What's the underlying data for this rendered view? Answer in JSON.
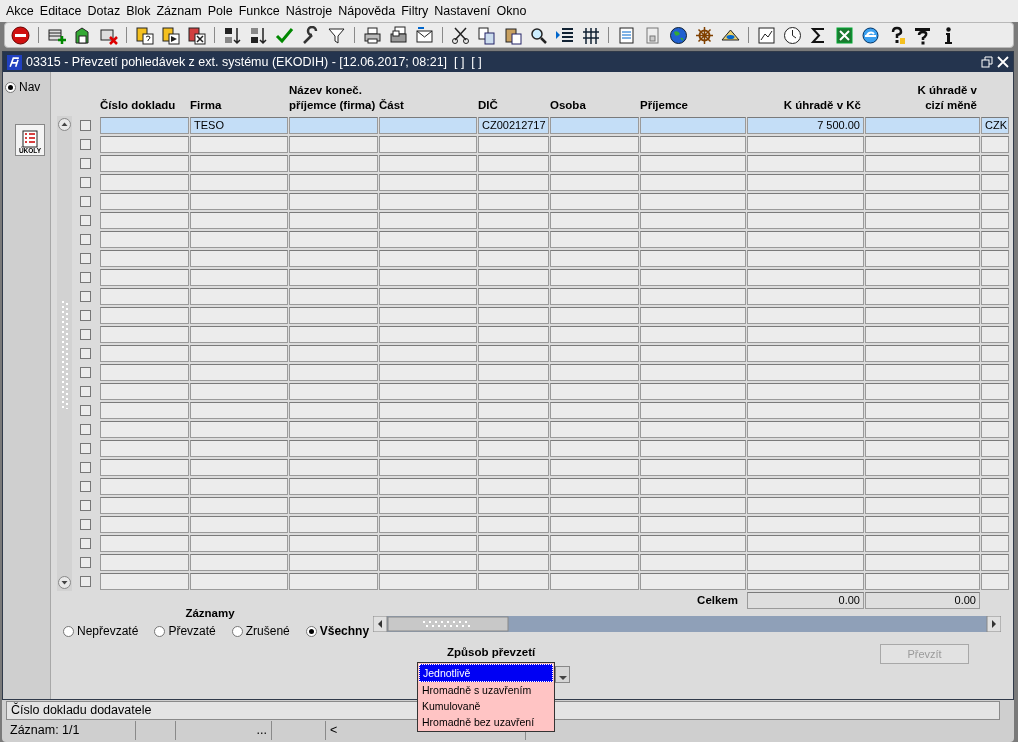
{
  "menu": [
    "Akce",
    "Editace",
    "Dotaz",
    "Blok",
    "Záznam",
    "Pole",
    "Funkce",
    "Nástroje",
    "Nápověda",
    "Filtry",
    "Nastavení",
    "Okno"
  ],
  "window": {
    "title": "03315 - Převzetí pohledávek z ext. systému (EKODIH) - [12.06.2017; 08:21]  [ ]  [ ]"
  },
  "nav": {
    "label": "Nav",
    "selected": true,
    "button": "ÚKOLY"
  },
  "table": {
    "columns": [
      {
        "label": "Číslo dokladu",
        "kind": "text"
      },
      {
        "label": "Firma",
        "kind": "text"
      },
      {
        "label": "Název koneč. příjemce (firma)",
        "kind": "text"
      },
      {
        "label": "Část",
        "kind": "text"
      },
      {
        "label": "DIČ",
        "kind": "text"
      },
      {
        "label": "Osoba",
        "kind": "text"
      },
      {
        "label": "Příjemce",
        "kind": "text"
      },
      {
        "label": "K úhradě v Kč",
        "kind": "amount"
      },
      {
        "label": "K úhradě v cizí měně",
        "kind": "amount"
      },
      {
        "kind": "text"
      }
    ],
    "rows": [
      {
        "selected": true,
        "checked": false,
        "cells": [
          "",
          "TESO",
          "",
          "",
          "CZ00212717",
          "",
          "",
          "7 500.00",
          "",
          "CZK"
        ]
      },
      {
        "selected": false,
        "checked": false
      },
      {
        "selected": false,
        "checked": false
      },
      {
        "selected": false,
        "checked": false
      },
      {
        "selected": false,
        "checked": false
      },
      {
        "selected": false,
        "checked": false
      },
      {
        "selected": false,
        "checked": false
      },
      {
        "selected": false,
        "checked": false
      },
      {
        "selected": false,
        "checked": false
      },
      {
        "selected": false,
        "checked": false
      },
      {
        "selected": false,
        "checked": false
      },
      {
        "selected": false,
        "checked": false
      },
      {
        "selected": false,
        "checked": false
      },
      {
        "selected": false,
        "checked": false
      },
      {
        "selected": false,
        "checked": false
      },
      {
        "selected": false,
        "checked": false
      },
      {
        "selected": false,
        "checked": false
      },
      {
        "selected": false,
        "checked": false
      },
      {
        "selected": false,
        "checked": false
      },
      {
        "selected": false,
        "checked": false
      },
      {
        "selected": false,
        "checked": false
      },
      {
        "selected": false,
        "checked": false
      },
      {
        "selected": false,
        "checked": false
      },
      {
        "selected": false,
        "checked": false
      },
      {
        "selected": false,
        "checked": false
      }
    ],
    "totals": {
      "label": "Celkem",
      "values": [
        "0.00",
        "0.00"
      ]
    }
  },
  "records_filter": {
    "title": "Záznamy",
    "options": [
      {
        "label": "Nepřevzaté",
        "selected": false
      },
      {
        "label": "Převzaté",
        "selected": false
      },
      {
        "label": "Zrušené",
        "selected": false
      },
      {
        "label": "Všechny",
        "selected": true
      }
    ]
  },
  "transfer_mode": {
    "label": "Způsob převzetí",
    "expanded": true,
    "options": [
      {
        "label": "Jednotlivě",
        "selected": true
      },
      {
        "label": "Hromadně s uzavřením",
        "selected": false
      },
      {
        "label": "Kumulovaně",
        "selected": false
      },
      {
        "label": "Hromadně bez uzavření",
        "selected": false
      }
    ]
  },
  "take_over_button": {
    "label": "Převzít",
    "disabled": true
  },
  "status_bar": {
    "hint": "Číslo dokladu dodavatele",
    "segments": [
      "Záznam: 1/1",
      "...",
      "<"
    ]
  }
}
